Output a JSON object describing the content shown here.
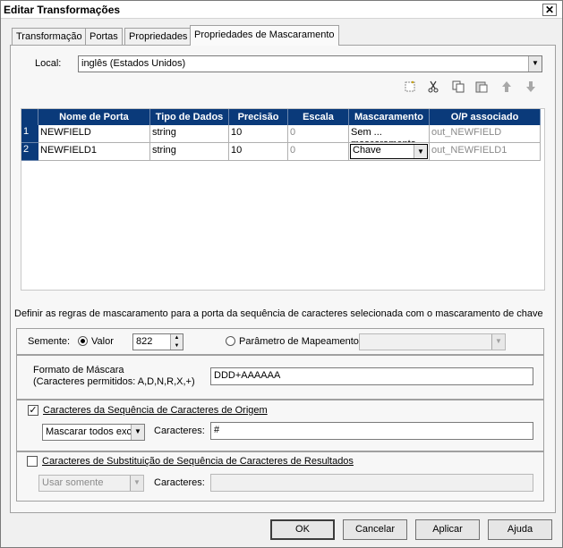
{
  "window": {
    "title": "Editar Transformações",
    "close_glyph": "✕"
  },
  "tabs": [
    {
      "label": "Transformação"
    },
    {
      "label": "Portas"
    },
    {
      "label": "Propriedades"
    },
    {
      "label": "Propriedades de Mascaramento",
      "active": true
    }
  ],
  "locale": {
    "label": "Local:",
    "value": "inglês (Estados Unidos)"
  },
  "toolbar_icons": [
    "new-icon",
    "cut-icon",
    "copy-icon",
    "paste-icon",
    "move-up-icon",
    "move-down-icon"
  ],
  "grid": {
    "columns": [
      "Nome de Porta",
      "Tipo de Dados",
      "Precisão",
      "Escala",
      "Mascaramento",
      "O/P associado"
    ],
    "rows": [
      {
        "num": "1",
        "port": "NEWFIELD",
        "type": "string",
        "precision": "10",
        "scale": "0",
        "masking": "Sem ... mascaramento",
        "output": "out_NEWFIELD"
      },
      {
        "num": "2",
        "port": "NEWFIELD1",
        "type": "string",
        "precision": "10",
        "scale": "0",
        "masking": "Chave",
        "output": "out_NEWFIELD1"
      }
    ]
  },
  "rules_description": "Definir as regras de mascaramento para a porta da sequência de caracteres selecionada com o mascaramento de chave",
  "seed": {
    "label": "Semente:",
    "value_option": "Valor",
    "value": "822",
    "mapping_option": "Parâmetro de Mapeamento",
    "mapping_value": ""
  },
  "mask_format": {
    "label_line1": "Formato de Máscara",
    "label_line2": "(Caracteres permitidos: A,D,N,R,X,+)",
    "value": "DDD+AAAAAA"
  },
  "source_chars": {
    "label": "Caracteres da Sequência de Caracteres de Origem",
    "checked": true,
    "mode": "Mascarar todos exc",
    "chars_label": "Caracteres:",
    "chars_value": "#"
  },
  "result_chars": {
    "label": "Caracteres de Substituição de Sequência de Caracteres de Resultados",
    "checked": false,
    "mode": "Usar somente",
    "chars_label": "Caracteres:",
    "chars_value": ""
  },
  "buttons": {
    "ok": "OK",
    "cancel": "Cancelar",
    "apply": "Aplicar",
    "help": "Ajuda"
  },
  "colors": {
    "grid_header": "#0a3a7a",
    "window_bg": "#f0f0f0"
  }
}
